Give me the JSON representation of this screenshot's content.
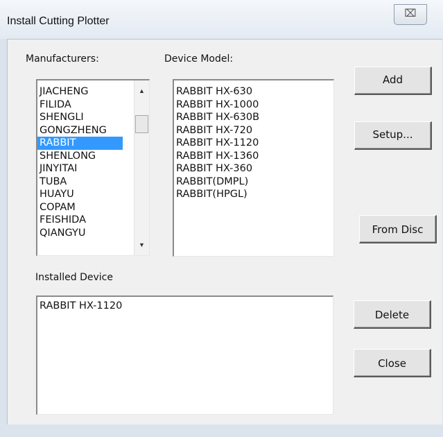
{
  "window": {
    "title": "Install Cutting Plotter",
    "close_glyph": "⌧"
  },
  "manufacturers": {
    "label": "Manufacturers:",
    "items": [
      "JIACHENG",
      "FILIDA",
      "SHENGLI",
      "GONGZHENG",
      "RABBIT",
      "SHENLONG",
      "JINYITAI",
      "TUBA",
      "HUAYU",
      "COPAM",
      "FEISHIDA",
      "QIANGYU"
    ],
    "selected": "RABBIT"
  },
  "device_model": {
    "label": "Device Model:",
    "items": [
      "RABBIT HX-630",
      "RABBIT HX-1000",
      "RABBIT HX-630B",
      "RABBIT HX-720",
      "RABBIT HX-1120",
      "RABBIT HX-1360",
      "RABBIT HX-360",
      "RABBIT(DMPL)",
      "RABBIT(HPGL)"
    ]
  },
  "installed": {
    "label": "Installed Device",
    "items": [
      "RABBIT HX-1120"
    ]
  },
  "buttons": {
    "add": "Add",
    "setup": "Setup...",
    "from_disc": "From Disc",
    "delete": "Delete",
    "close": "Close"
  },
  "icons": {
    "scroll_up": "▲",
    "scroll_down": "▼"
  }
}
